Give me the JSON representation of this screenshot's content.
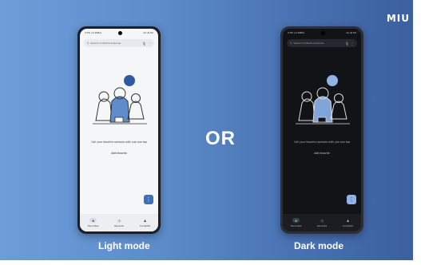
{
  "brand": "MIU",
  "separator": "OR",
  "phones": [
    {
      "caption": "Light mode",
      "status_time": "2:56 | 0.1KB/s",
      "status_right": "ull ull 62",
      "search_placeholder": "Search contacts & places",
      "empty_message": "Call your favorite contacts with just one tap",
      "add_favorite": "Add favorite",
      "fab_icon": "dialpad-icon",
      "nav": [
        "Favorites",
        "Recents",
        "Contacts"
      ]
    },
    {
      "caption": "Dark mode",
      "status_time": "2:56 | 0.1KB/s",
      "status_right": "ull ull 62",
      "search_placeholder": "Search contacts & places",
      "empty_message": "Call your favorite contacts with just one tap",
      "add_favorite": "Add favorite",
      "fab_icon": "dialpad-icon",
      "nav": [
        "Favorites",
        "Recents",
        "Contacts"
      ]
    }
  ],
  "colors": {
    "background_left": "#6d9dd9",
    "background_right": "#3b5f9f",
    "accent": "#3f6fb4"
  }
}
